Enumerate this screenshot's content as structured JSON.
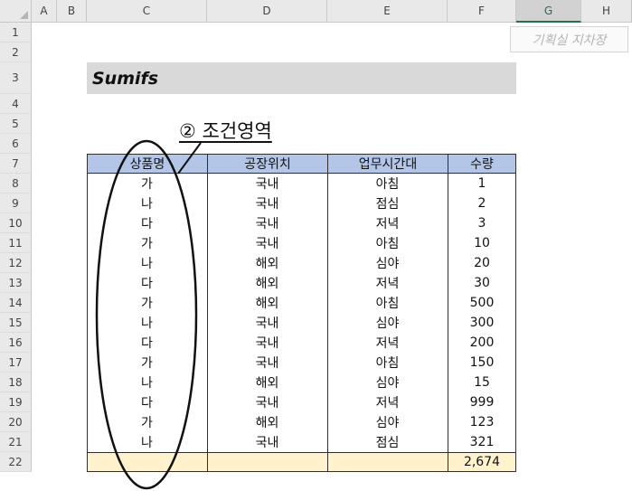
{
  "columns": [
    "A",
    "B",
    "C",
    "D",
    "E",
    "F",
    "G",
    "H"
  ],
  "selected_column": "G",
  "rows": [
    "1",
    "2",
    "3",
    "4",
    "5",
    "6",
    "7",
    "8",
    "9",
    "10",
    "11",
    "12",
    "13",
    "14",
    "15",
    "16",
    "17",
    "18",
    "19",
    "20",
    "21",
    "22"
  ],
  "stamp": "기획실 지차장",
  "title": "Sumifs",
  "annotation": "② 조건영역",
  "table": {
    "headers": [
      "상품명",
      "공장위치",
      "업무시간대",
      "수량"
    ],
    "rows": [
      [
        "가",
        "국내",
        "아침",
        "1"
      ],
      [
        "나",
        "국내",
        "점심",
        "2"
      ],
      [
        "다",
        "국내",
        "저녁",
        "3"
      ],
      [
        "가",
        "국내",
        "아침",
        "10"
      ],
      [
        "나",
        "해외",
        "심야",
        "20"
      ],
      [
        "다",
        "해외",
        "저녁",
        "30"
      ],
      [
        "가",
        "해외",
        "아침",
        "500"
      ],
      [
        "나",
        "국내",
        "심야",
        "300"
      ],
      [
        "다",
        "국내",
        "저녁",
        "200"
      ],
      [
        "가",
        "국내",
        "아침",
        "150"
      ],
      [
        "나",
        "해외",
        "심야",
        "15"
      ],
      [
        "다",
        "국내",
        "저녁",
        "999"
      ],
      [
        "가",
        "해외",
        "심야",
        "123"
      ],
      [
        "나",
        "국내",
        "점심",
        "321"
      ]
    ],
    "total": [
      "",
      "",
      "",
      "2,674"
    ]
  },
  "colors": {
    "header_fill": "#b4c6e7",
    "title_fill": "#d9d9d9",
    "total_fill": "#fff2cc",
    "selected_column_accent": "#217346"
  }
}
